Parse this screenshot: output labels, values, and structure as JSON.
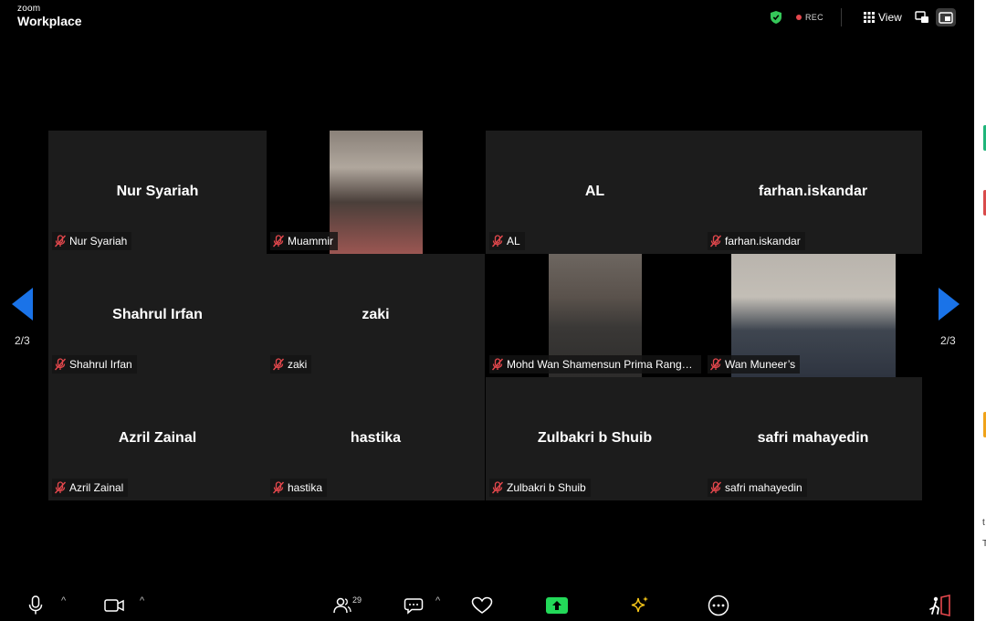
{
  "app": {
    "brand_top": "zoom",
    "brand_bottom": "Workplace"
  },
  "header": {
    "rec_label": "REC",
    "view_label": "View"
  },
  "pagination": {
    "left": "2/3",
    "right": "2/3"
  },
  "participants": [
    {
      "name": "Nur Syariah",
      "label": "Nur Syariah",
      "video": false
    },
    {
      "name": "",
      "label": "Muammir",
      "video": true
    },
    {
      "name": "AL",
      "label": "AL",
      "video": false
    },
    {
      "name": "farhan.iskandar",
      "label": "farhan.iskandar",
      "video": false
    },
    {
      "name": "Shahrul Irfan",
      "label": "Shahrul Irfan",
      "video": false
    },
    {
      "name": "zaki",
      "label": "zaki",
      "video": false
    },
    {
      "name": "",
      "label": "Mohd Wan Shamensun Prima Ranggu T...",
      "video": true
    },
    {
      "name": "",
      "label": "Wan Muneer’s",
      "video": true
    },
    {
      "name": "Azril Zainal",
      "label": "Azril Zainal",
      "video": false
    },
    {
      "name": "hastika",
      "label": "hastika",
      "video": false
    },
    {
      "name": "Zulbakri b Shuib",
      "label": "Zulbakri b Shuib",
      "video": false
    },
    {
      "name": "safri mahayedin",
      "label": "safri mahayedin",
      "video": false
    }
  ],
  "toolbar": {
    "participants_count": "29"
  },
  "colors": {
    "accent_blue": "#1a73e8",
    "muted_red": "#e5484d",
    "share_green": "#23d959",
    "shield_green": "#35c759",
    "ai_yellow": "#f5c518"
  },
  "side_panel": {
    "line1": "t",
    "line2": "T"
  }
}
